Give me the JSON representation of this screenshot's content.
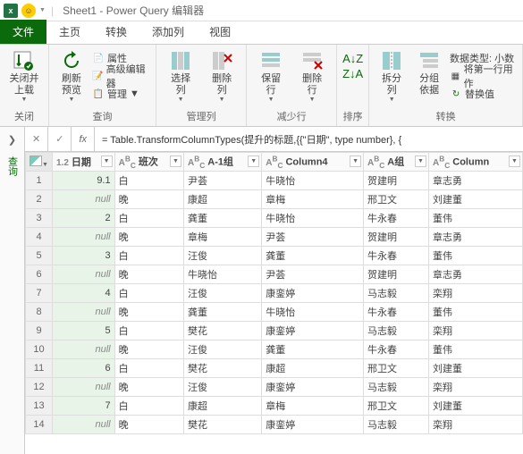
{
  "title": "Sheet1 - Power Query 编辑器",
  "tabs": {
    "file": "文件",
    "home": "主页",
    "transform": "转换",
    "addcol": "添加列",
    "view": "视图"
  },
  "ribbon": {
    "close": {
      "big": "关闭并\n上载",
      "group": "关闭"
    },
    "query": {
      "refresh": "刷新\n预览",
      "props": "属性",
      "adv": "高级编辑器",
      "manage": "管理",
      "group": "查询"
    },
    "cols": {
      "choose": "选择\n列",
      "remove": "删除\n列",
      "group": "管理列"
    },
    "rows": {
      "keep": "保留\n行",
      "removerow": "删除\n行",
      "group": "减少行"
    },
    "sort": {
      "group": "排序"
    },
    "split": {
      "split": "拆分\n列",
      "groupby": "分组\n依据"
    },
    "transform": {
      "dtype": "数据类型: 小数",
      "firstrow": "将第一行用作",
      "replace": "替换值",
      "group": "转换"
    }
  },
  "sidebar": {
    "label": "查询"
  },
  "formula": "= Table.TransformColumnTypes(提升的标题,{{\"日期\", type number}, {",
  "columns": [
    "日期",
    "班次",
    "A-1组",
    "Column4",
    "A组",
    "Column"
  ],
  "coltypes": [
    "1.2",
    "ABC",
    "ABC",
    "ABC",
    "ABC",
    "ABC"
  ],
  "rows": [
    [
      "9.1",
      "白",
      "尹荟",
      "牛晓怡",
      "贺建明",
      "章志勇"
    ],
    [
      "null",
      "晚",
      "康超",
      "章梅",
      "邢卫文",
      "刘建董"
    ],
    [
      "2",
      "白",
      "龚董",
      "牛晓怡",
      "牛永春",
      "董伟"
    ],
    [
      "null",
      "晚",
      "章梅",
      "尹荟",
      "贺建明",
      "章志勇"
    ],
    [
      "3",
      "白",
      "汪俊",
      "龚董",
      "牛永春",
      "董伟"
    ],
    [
      "null",
      "晚",
      "牛晓怡",
      "尹荟",
      "贺建明",
      "章志勇"
    ],
    [
      "4",
      "白",
      "汪俊",
      "康銮婷",
      "马志毅",
      "栾翔"
    ],
    [
      "null",
      "晚",
      "龚董",
      "牛晓怡",
      "牛永春",
      "董伟"
    ],
    [
      "5",
      "白",
      "樊花",
      "康銮婷",
      "马志毅",
      "栾翔"
    ],
    [
      "null",
      "晚",
      "汪俊",
      "龚董",
      "牛永春",
      "董伟"
    ],
    [
      "6",
      "白",
      "樊花",
      "康超",
      "邢卫文",
      "刘建董"
    ],
    [
      "null",
      "晚",
      "汪俊",
      "康銮婷",
      "马志毅",
      "栾翔"
    ],
    [
      "7",
      "白",
      "康超",
      "章梅",
      "邢卫文",
      "刘建董"
    ],
    [
      "null",
      "晚",
      "樊花",
      "康銮婷",
      "马志毅",
      "栾翔"
    ]
  ]
}
